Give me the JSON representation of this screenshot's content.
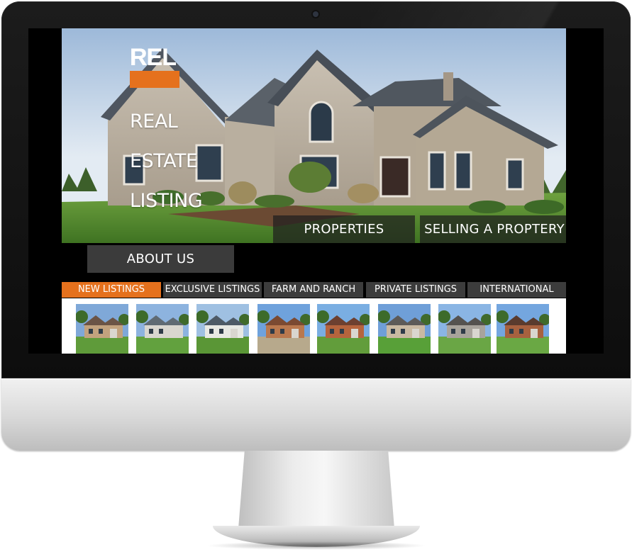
{
  "site": {
    "logo_mark": "REL",
    "logo_lines": [
      "REAL",
      "ESTATE",
      "LISTING"
    ]
  },
  "nav": {
    "properties": "PROPERTIES",
    "selling": "SELLING A PROPTERY",
    "about": "ABOUT US"
  },
  "tabs": [
    {
      "label": "NEW LISTINGS",
      "active": true
    },
    {
      "label": "EXCLUSIVE LISTINGS",
      "active": false
    },
    {
      "label": "FARM AND RANCH",
      "active": false
    },
    {
      "label": "PRIVATE LISTINGS",
      "active": false
    },
    {
      "label": "INTERNATIONAL",
      "active": false
    }
  ],
  "listings": [
    {
      "sky": "#7fa8d8",
      "house": "#c2a27e",
      "roof": "#6b5446",
      "lawn": "#5f9b3a"
    },
    {
      "sky": "#8db3df",
      "house": "#d8d6cf",
      "roof": "#5f6a73",
      "lawn": "#62a13e"
    },
    {
      "sky": "#9fc0e2",
      "house": "#e8e8e3",
      "roof": "#4e5a66",
      "lawn": "#5a9636"
    },
    {
      "sky": "#6fa2dc",
      "house": "#b9784e",
      "roof": "#7b4a32",
      "lawn": "#b7a98c"
    },
    {
      "sky": "#7aaee2",
      "house": "#b5643d",
      "roof": "#6d4030",
      "lawn": "#629d3b"
    },
    {
      "sky": "#6f9fd8",
      "house": "#c9b9a2",
      "roof": "#5d5a58",
      "lawn": "#58a038"
    },
    {
      "sky": "#8ab5e4",
      "house": "#a8a39b",
      "roof": "#55524f",
      "lawn": "#6aa645"
    },
    {
      "sky": "#74a6df",
      "house": "#a7613f",
      "roof": "#5a3b2e",
      "lawn": "#6aa844"
    }
  ],
  "colors": {
    "accent": "#e5711d",
    "tab_bg": "#3c3c3c",
    "nav_overlay": "rgba(30,30,30,0.72)"
  }
}
